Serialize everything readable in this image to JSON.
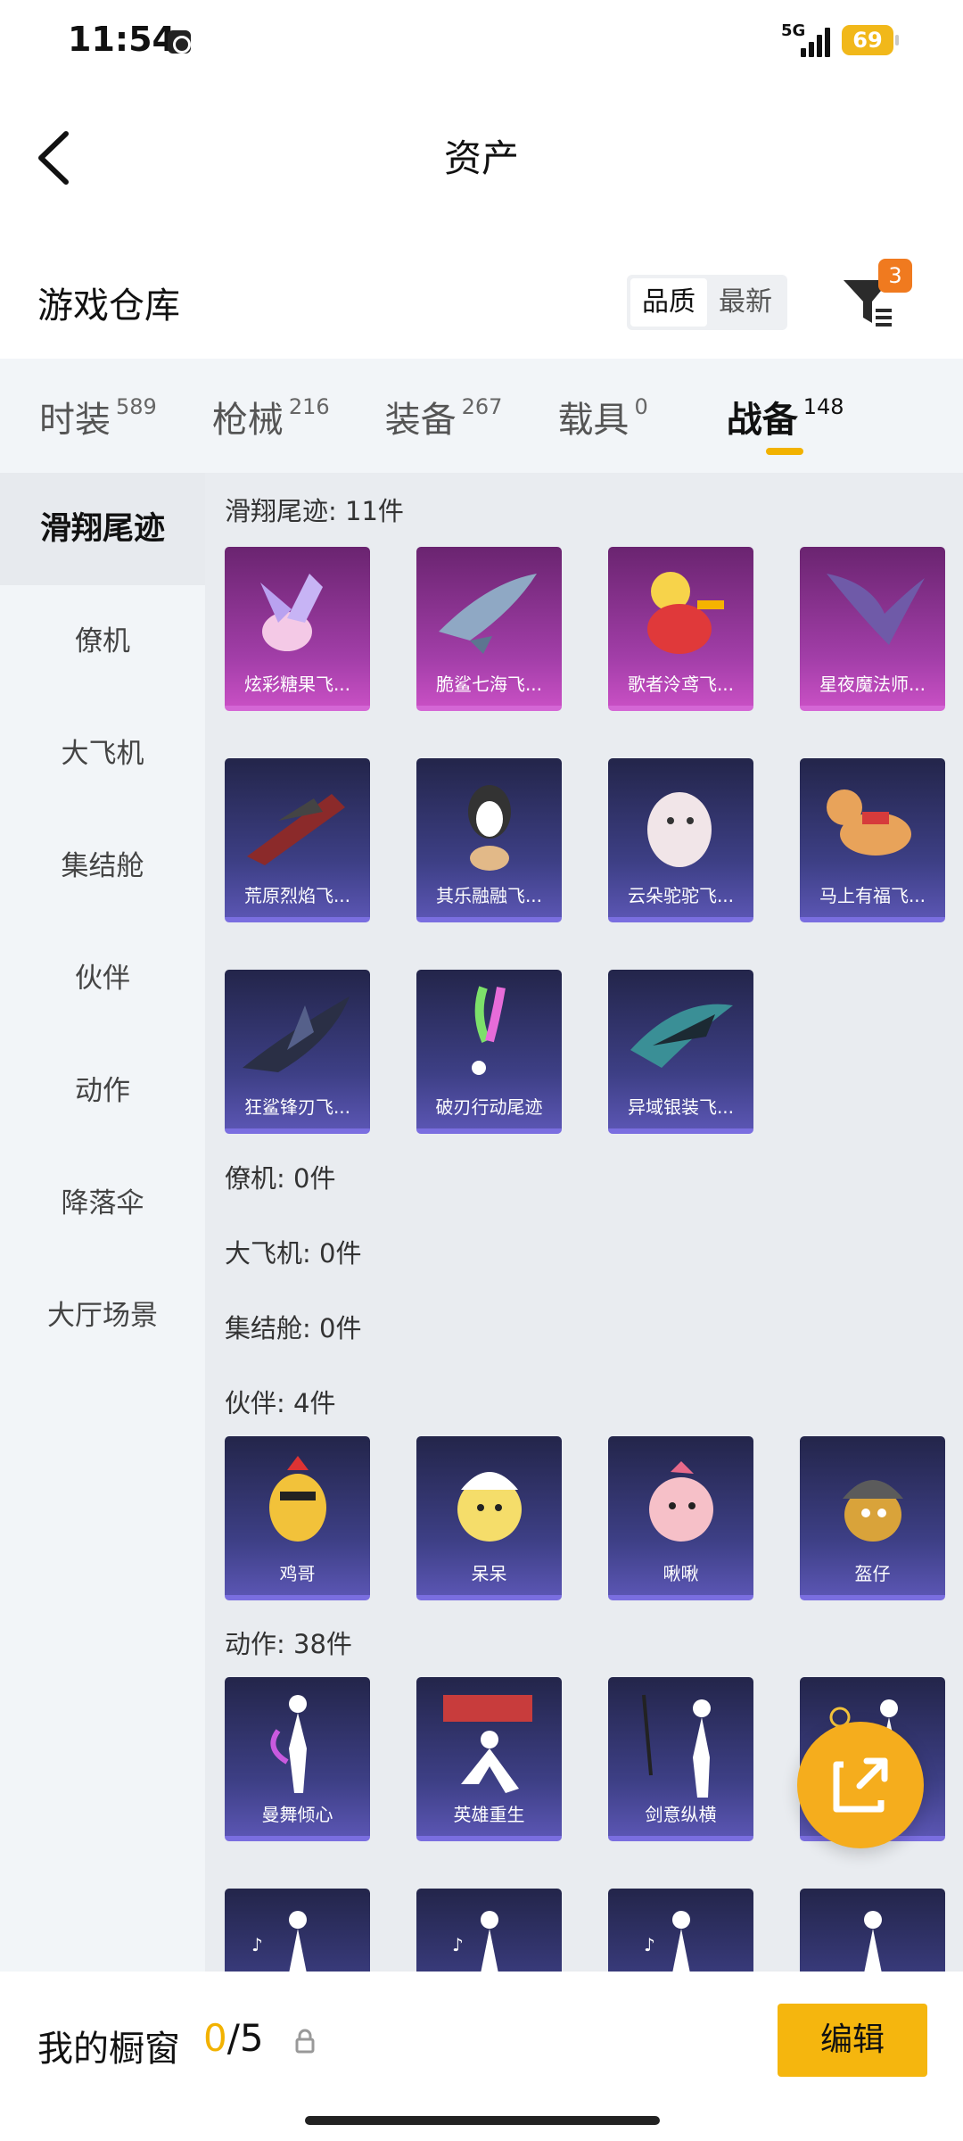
{
  "status_bar": {
    "time": "11:54",
    "network": "5G",
    "battery": "69"
  },
  "nav": {
    "title": "资产"
  },
  "warehouse": {
    "title": "游戏仓库",
    "sort_options": [
      "品质",
      "最新"
    ],
    "active_sort": "品质",
    "filter_badge": "3"
  },
  "tabs": [
    {
      "label": "时装",
      "count": "589"
    },
    {
      "label": "枪械",
      "count": "216"
    },
    {
      "label": "装备",
      "count": "267"
    },
    {
      "label": "载具",
      "count": "0"
    },
    {
      "label": "战备",
      "count": "148"
    }
  ],
  "active_tab": "战备",
  "sidebar": [
    "滑翔尾迹",
    "僚机",
    "大飞机",
    "集结舱",
    "伙伴",
    "动作",
    "降落伞",
    "大厅场景"
  ],
  "active_sidebar": "滑翔尾迹",
  "sections": {
    "glide_trail": {
      "title": "滑翔尾迹: 11件",
      "items": [
        "炫彩糖果飞...",
        "脆鲨七海飞...",
        "歌者泠鸢飞...",
        "星夜魔法师...",
        "荒原烈焰飞...",
        "其乐融融飞...",
        "云朵驼驼飞...",
        "马上有福飞...",
        "狂鲨锋刃飞...",
        "破刃行动尾迹",
        "异域银装飞..."
      ]
    },
    "wingman": {
      "title": "僚机: 0件"
    },
    "big_plane": {
      "title": "大飞机: 0件"
    },
    "assembly": {
      "title": "集结舱: 0件"
    },
    "partner": {
      "title": "伙伴: 4件",
      "items": [
        "鸡哥",
        "呆呆",
        "啾啾",
        "盔仔"
      ]
    },
    "emote": {
      "title": "动作: 38件",
      "items": [
        "曼舞倾心",
        "英雄重生",
        "剑意纵横",
        ""
      ]
    }
  },
  "bottom": {
    "showcase_label": "我的橱窗",
    "current": "0",
    "total": "/5",
    "edit_label": "编辑"
  },
  "colors": {
    "accent": "#f5b60e",
    "badge": "#f07a1f",
    "purple_card": "#a23ea8",
    "blue_card": "#3d3f85"
  }
}
